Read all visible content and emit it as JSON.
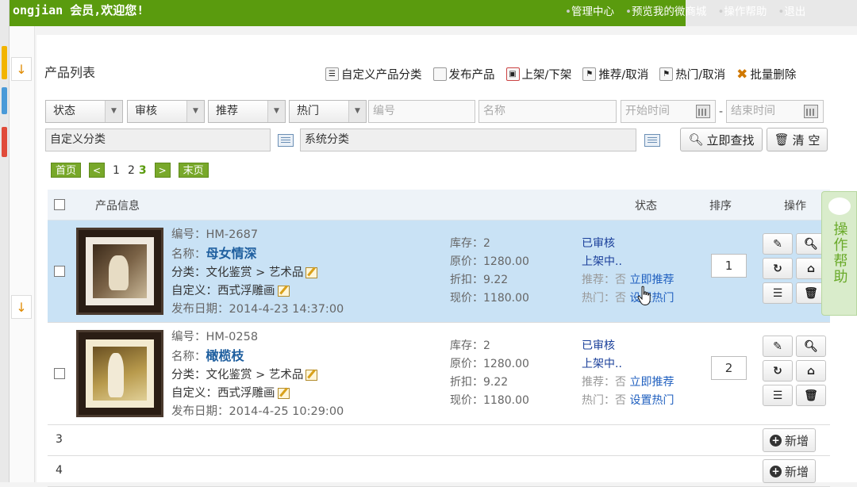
{
  "topbar": {
    "welcome": "ongjian 会员,欢迎您!",
    "nav": [
      "管理中心",
      "预览我的微商城",
      "操作帮助",
      "退出"
    ]
  },
  "page": {
    "title": "产品列表"
  },
  "toolbar": {
    "custom_category": "自定义产品分类",
    "publish": "发布产品",
    "shelve": "上架/下架",
    "recommend": "推荐/取消",
    "hot": "热门/取消",
    "batch_delete": "批量删除"
  },
  "filters": {
    "status": "状态",
    "review": "审核",
    "recommend": "推荐",
    "hot": "热门",
    "code_placeholder": "编号",
    "name_placeholder": "名称",
    "start_placeholder": "开始时间",
    "end_placeholder": "结束时间",
    "date_sep": "-",
    "custom_category": "自定义分类",
    "system_category": "系统分类",
    "search": "立即查找",
    "clear": "清 空"
  },
  "pager": {
    "first": "首页",
    "prev": "<",
    "pages": [
      "1",
      "2",
      "3"
    ],
    "next": ">",
    "last": "末页"
  },
  "table": {
    "headers": {
      "info": "产品信息",
      "status": "状态",
      "sort": "排序",
      "ops": "操作"
    },
    "rows": [
      {
        "code": "编号：HM-2687",
        "name_label": "名称：",
        "name": "母女情深",
        "category": "分类：文化鉴赏 > 艺术品",
        "custom": "自定义：西式浮雕画",
        "date": "发布日期：2014-4-23 14:37:00",
        "stock": "库存：2",
        "orig": "原价：1280.00",
        "discount": "折扣：9.22",
        "now": "现价：1180.00",
        "review": "已审核",
        "shelf": "上架中..",
        "rec_label": "推荐：否",
        "rec_link": "立即推荐",
        "hot_label": "热门：否",
        "hot_link": "设置热门",
        "sort": "1",
        "selected": true
      },
      {
        "code": "编号：HM-0258",
        "name_label": "名称：",
        "name": "橄榄枝",
        "category": "分类：文化鉴赏 > 艺术品",
        "custom": "自定义：西式浮雕画",
        "date": "发布日期：2014-4-25 10:29:00",
        "stock": "库存：2",
        "orig": "原价：1280.00",
        "discount": "折扣：9.22",
        "now": "现价：1180.00",
        "review": "已审核",
        "shelf": "上架中..",
        "rec_label": "推荐：否",
        "rec_link": "立即推荐",
        "hot_label": "热门：否",
        "hot_link": "设置热门",
        "sort": "2",
        "selected": false
      }
    ],
    "empty_rows": [
      {
        "num": "3",
        "add": "新增"
      },
      {
        "num": "4",
        "add": "新增"
      }
    ]
  },
  "help": {
    "label": "操作帮助"
  },
  "colors": {
    "brand_green": "#5a9b0e",
    "selected_row": "#c9e2f5",
    "link_blue": "#1f5fbf"
  }
}
